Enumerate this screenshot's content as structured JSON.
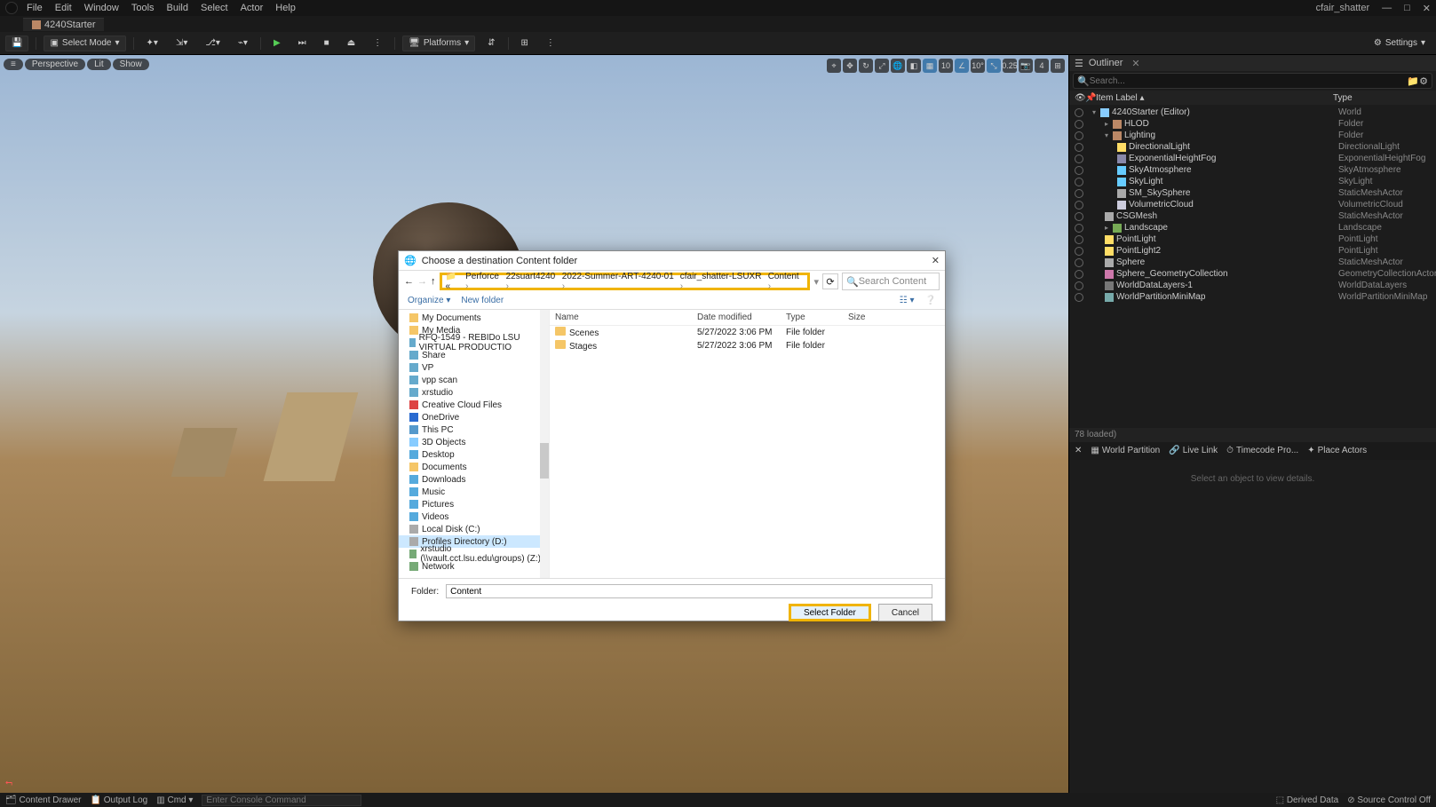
{
  "menu": {
    "items": [
      "File",
      "Edit",
      "Window",
      "Tools",
      "Build",
      "Select",
      "Actor",
      "Help"
    ]
  },
  "title_user": "cfair_shatter",
  "tab": {
    "label": "4240Starter"
  },
  "toolbar": {
    "save_icon": "save",
    "select_mode": "Select Mode",
    "platforms": "Platforms",
    "settings": "Settings"
  },
  "viewport": {
    "tl": [
      "≡",
      "Perspective",
      "Lit",
      "Show"
    ],
    "tr_labels": {
      "grid": "10",
      "angle": "10°",
      "scale": "0.25",
      "cam": "4"
    }
  },
  "outliner": {
    "title": "Outliner",
    "search_placeholder": "Search...",
    "col_label": "Item Label",
    "col_type": "Type",
    "rows": [
      {
        "ind": 0,
        "caret": "open",
        "icon": "world",
        "label": "4240Starter (Editor)",
        "type": "World"
      },
      {
        "ind": 1,
        "caret": "closed",
        "icon": "folder",
        "label": "HLOD",
        "type": "Folder"
      },
      {
        "ind": 1,
        "caret": "open",
        "icon": "folder",
        "label": "Lighting",
        "type": "Folder"
      },
      {
        "ind": 2,
        "icon": "light",
        "label": "DirectionalLight",
        "type": "DirectionalLight"
      },
      {
        "ind": 2,
        "icon": "fog",
        "label": "ExponentialHeightFog",
        "type": "ExponentialHeightFog"
      },
      {
        "ind": 2,
        "icon": "sky",
        "label": "SkyAtmosphere",
        "type": "SkyAtmosphere"
      },
      {
        "ind": 2,
        "icon": "sky",
        "label": "SkyLight",
        "type": "SkyLight"
      },
      {
        "ind": 2,
        "icon": "mesh",
        "label": "SM_SkySphere",
        "type": "StaticMeshActor"
      },
      {
        "ind": 2,
        "icon": "cloud",
        "label": "VolumetricCloud",
        "type": "VolumetricCloud"
      },
      {
        "ind": 1,
        "icon": "mesh",
        "label": "CSGMesh",
        "type": "StaticMeshActor"
      },
      {
        "ind": 1,
        "caret": "closed",
        "icon": "land",
        "label": "Landscape",
        "type": "Landscape"
      },
      {
        "ind": 1,
        "icon": "light",
        "label": "PointLight",
        "type": "PointLight"
      },
      {
        "ind": 1,
        "icon": "light",
        "label": "PointLight2",
        "type": "PointLight"
      },
      {
        "ind": 1,
        "icon": "mesh",
        "label": "Sphere",
        "type": "StaticMeshActor"
      },
      {
        "ind": 1,
        "icon": "geom",
        "label": "Sphere_GeometryCollection",
        "type": "GeometryCollectionActor"
      },
      {
        "ind": 1,
        "icon": "data",
        "label": "WorldDataLayers-1",
        "type": "WorldDataLayers"
      },
      {
        "ind": 1,
        "icon": "map",
        "label": "WorldPartitionMiniMap",
        "type": "WorldPartitionMiniMap"
      }
    ],
    "status": "78 loaded)"
  },
  "details": {
    "tabs": [
      "World Partition",
      "Live Link",
      "Timecode Pro...",
      "Place Actors"
    ],
    "hint": "Select an object to view details."
  },
  "bottom": {
    "content_drawer": "Content Drawer",
    "output_log": "Output Log",
    "cmd": "Cmd",
    "cmd_placeholder": "Enter Console Command",
    "derived": "Derived Data",
    "source": "Source Control Off"
  },
  "dialog": {
    "title": "Choose a destination Content folder",
    "crumbs": [
      "Perforce",
      "22suart4240",
      "2022-Summer-ART-4240-01",
      "cfair_shatter-LSUXR",
      "Content"
    ],
    "search_placeholder": "Search Content",
    "organize": "Organize",
    "new_folder": "New folder",
    "nav": [
      {
        "icon": "doc",
        "label": "My Documents"
      },
      {
        "icon": "doc",
        "label": "My Media"
      },
      {
        "icon": "link",
        "label": "RFQ-1549 - REBIDo LSU VIRTUAL PRODUCTIO"
      },
      {
        "icon": "link",
        "label": "Share"
      },
      {
        "icon": "link",
        "label": "VP"
      },
      {
        "icon": "link",
        "label": "vpp scan"
      },
      {
        "icon": "link",
        "label": "xrstudio"
      },
      {
        "icon": "cc",
        "label": "Creative Cloud Files"
      },
      {
        "icon": "od",
        "label": "OneDrive"
      },
      {
        "icon": "pc",
        "label": "This PC"
      },
      {
        "icon": "3d",
        "label": "3D Objects"
      },
      {
        "icon": "desk",
        "label": "Desktop"
      },
      {
        "icon": "doc",
        "label": "Documents"
      },
      {
        "icon": "dl",
        "label": "Downloads"
      },
      {
        "icon": "mus",
        "label": "Music"
      },
      {
        "icon": "pic",
        "label": "Pictures"
      },
      {
        "icon": "vid",
        "label": "Videos"
      },
      {
        "icon": "disk",
        "label": "Local Disk (C:)"
      },
      {
        "icon": "disk",
        "label": "Profiles Directory (D:)",
        "selected": true
      },
      {
        "icon": "net",
        "label": "xrstudio (\\\\vault.cct.lsu.edu\\groups) (Z:)"
      },
      {
        "icon": "net",
        "label": "Network"
      }
    ],
    "cols": {
      "name": "Name",
      "date": "Date modified",
      "type": "Type",
      "size": "Size"
    },
    "files": [
      {
        "name": "Scenes",
        "date": "5/27/2022 3:06 PM",
        "type": "File folder"
      },
      {
        "name": "Stages",
        "date": "5/27/2022 3:06 PM",
        "type": "File folder"
      }
    ],
    "folder_label": "Folder:",
    "folder_value": "Content",
    "select": "Select Folder",
    "cancel": "Cancel"
  }
}
